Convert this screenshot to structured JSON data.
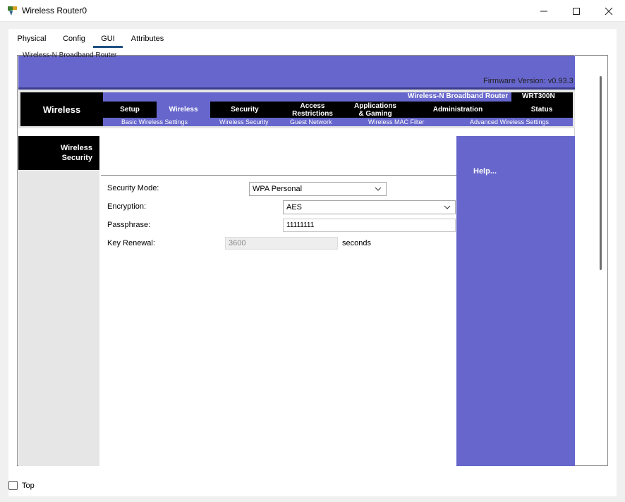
{
  "window": {
    "title": "Wireless Router0",
    "app_icon": "router-device-icon"
  },
  "tabs": [
    {
      "label": "Physical"
    },
    {
      "label": "Config"
    },
    {
      "label": "GUI",
      "active": true
    },
    {
      "label": "Attributes"
    }
  ],
  "router_ui": {
    "header_cut_text": "Wireless-N Broadband Router",
    "firmware_version": "Firmware Version: v0.93.3",
    "brand_section": "Wireless",
    "product_name": "Wireless-N Broadband Router",
    "model": "WRT300N",
    "nav": {
      "setup": "Setup",
      "wireless": "Wireless",
      "security": "Security",
      "access_line1": "Access",
      "access_line2": "Restrictions",
      "apps_line1": "Applications",
      "apps_line2": "& Gaming",
      "administration": "Administration",
      "status": "Status"
    },
    "subnav": {
      "basic": "Basic Wireless Settings",
      "wireless_security": "Wireless Security",
      "guest": "Guest Network",
      "mac_filter": "Wireless MAC Filter",
      "advanced": "Advanced Wireless Settings"
    },
    "section_title_line1": "Wireless",
    "section_title_line2": "Security",
    "help": "Help...",
    "form": {
      "security_mode_label": "Security Mode:",
      "security_mode_value": "WPA Personal",
      "encryption_label": "Encryption:",
      "encryption_value": "AES",
      "passphrase_label": "Passphrase:",
      "passphrase_value": "11111111",
      "key_renewal_label": "Key Renewal:",
      "key_renewal_value": "3600",
      "key_renewal_unit": "seconds"
    },
    "colors": {
      "accent": "#6666cc",
      "nav_bg": "#000000"
    }
  },
  "footer": {
    "top_label": "Top",
    "top_checked": false
  }
}
